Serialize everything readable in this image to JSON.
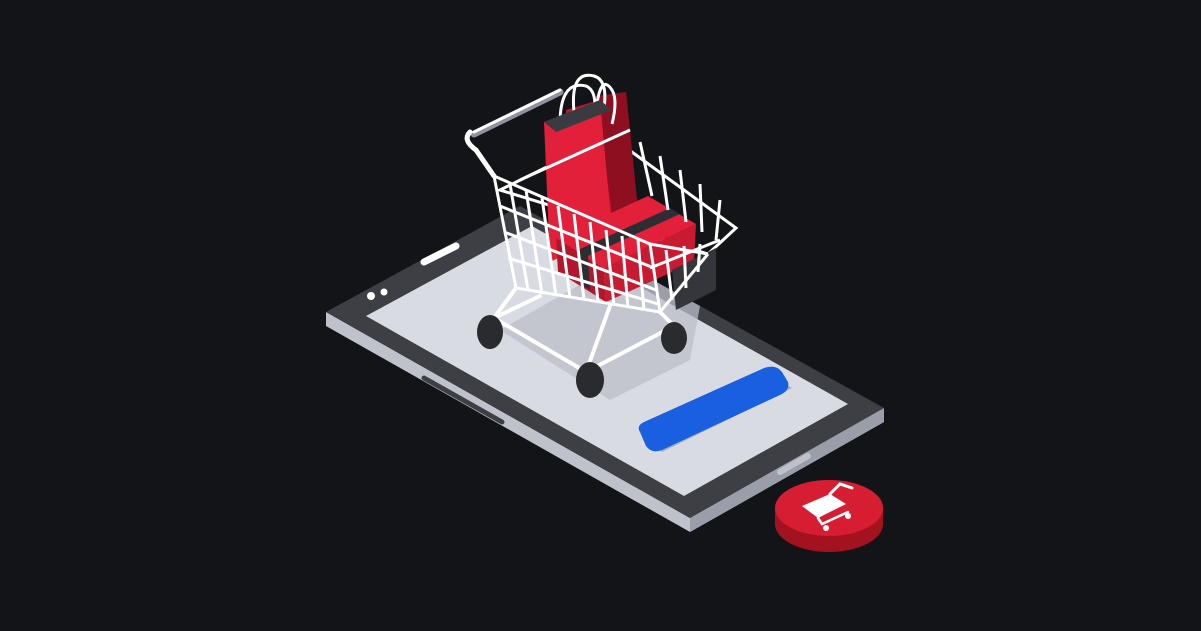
{
  "scene": {
    "background_color": "#121417",
    "accent_colors": {
      "bag_red": "#e3203a",
      "button_blue": "#1a5fe0",
      "phone_frame": "#3d3f45",
      "phone_screen": "#d9dbe2",
      "cart_wire": "#ffffff",
      "badge_red": "#d71d31"
    },
    "icons": [
      "smartphone-illustration",
      "shopping-cart-illustration",
      "shopping-bag-illustration",
      "cart-badge-icon"
    ]
  }
}
